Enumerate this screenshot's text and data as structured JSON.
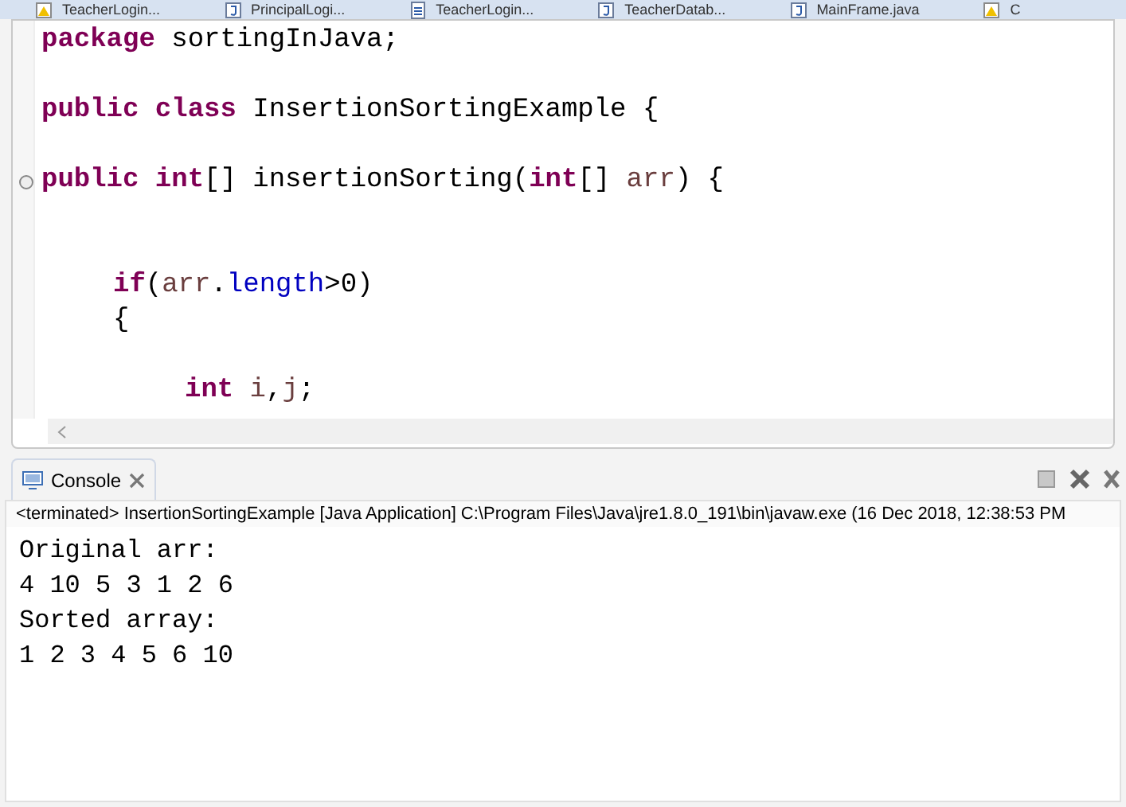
{
  "editor_tabs": [
    {
      "label": "TeacherLogin...",
      "kind": "warning"
    },
    {
      "label": "PrincipalLogi...",
      "kind": "java"
    },
    {
      "label": "TeacherLogin...",
      "kind": "file"
    },
    {
      "label": "TeacherDatab...",
      "kind": "java"
    },
    {
      "label": "MainFrame.java",
      "kind": "java"
    },
    {
      "label": "C",
      "kind": "warning"
    }
  ],
  "code_lines": [
    {
      "kind": "code",
      "fold": false,
      "tokens": [
        {
          "kind": "keyword",
          "text": "package"
        },
        {
          "kind": "plain",
          "text": " sortingInJava;"
        }
      ]
    },
    {
      "kind": "blank",
      "fold": false
    },
    {
      "kind": "code",
      "fold": false,
      "tokens": [
        {
          "kind": "keyword",
          "text": "public class"
        },
        {
          "kind": "plain",
          "text": " InsertionSortingExample {"
        }
      ]
    },
    {
      "kind": "blank",
      "fold": false
    },
    {
      "kind": "code",
      "fold": true,
      "tokens": [
        {
          "kind": "keyword",
          "text": "public int"
        },
        {
          "kind": "plain",
          "text": "[] insertionSorting("
        },
        {
          "kind": "keyword",
          "text": "int"
        },
        {
          "kind": "plain",
          "text": "[] "
        },
        {
          "kind": "variable",
          "text": "arr"
        },
        {
          "kind": "plain",
          "text": ") {"
        }
      ],
      "children": [
        {
          "kind": "blank",
          "fold": false
        },
        {
          "kind": "blank",
          "fold": false
        },
        {
          "kind": "code",
          "fold": false,
          "tokens": [
            {
              "kind": "keyword",
              "text": "if"
            },
            {
              "kind": "plain",
              "text": "("
            },
            {
              "kind": "variable",
              "text": "arr"
            },
            {
              "kind": "plain",
              "text": "."
            },
            {
              "kind": "field",
              "text": "length"
            },
            {
              "kind": "plain",
              "text": ">0)"
            }
          ]
        },
        {
          "kind": "code",
          "fold": false,
          "tokens": [
            {
              "kind": "plain",
              "text": "{"
            }
          ],
          "children": [
            {
              "kind": "blank",
              "fold": false
            },
            {
              "kind": "code",
              "fold": false,
              "tokens": [
                {
                  "kind": "keyword",
                  "text": "int"
                },
                {
                  "kind": "variable",
                  "text": " i"
                },
                {
                  "kind": "plain",
                  "text": ","
                },
                {
                  "kind": "variable",
                  "text": "j"
                },
                {
                  "kind": "plain",
                  "text": ";"
                }
              ]
            }
          ]
        }
      ]
    }
  ],
  "console": {
    "title": "Console",
    "status": "<terminated> InsertionSortingExample [Java Application] C:\\Program Files\\Java\\jre1.8.0_191\\bin\\javaw.exe (16 Dec 2018, 12:38:53 PM",
    "output": [
      "Original arr:",
      "4 10 5 3 1 2 6",
      "Sorted array:",
      "1 2 3 4 5 6 10"
    ]
  }
}
